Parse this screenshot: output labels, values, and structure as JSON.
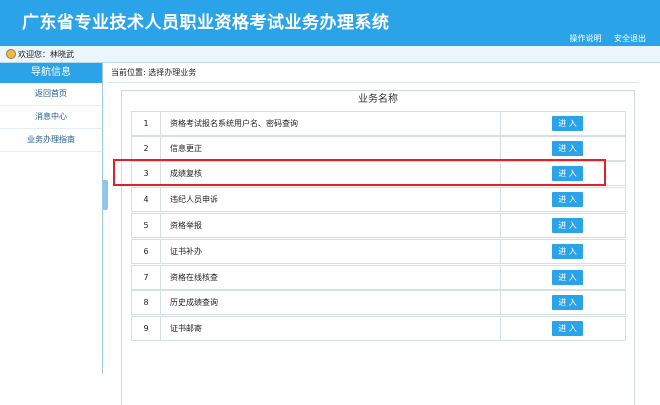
{
  "header": {
    "title": "广东省专业技术人员职业资格考试业务办理系统",
    "links": {
      "help": "操作说明",
      "logout": "安全退出"
    }
  },
  "userbar": {
    "welcome": "欢迎您：林晓武"
  },
  "sidebar": {
    "heading": "导航信息",
    "items": [
      {
        "label": "返回首页"
      },
      {
        "label": "消息中心"
      },
      {
        "label": "业务办理指南"
      }
    ]
  },
  "main": {
    "breadcrumb": "当前位置: 选择办理业务",
    "table_header": "业务名称",
    "rows": [
      {
        "num": "1",
        "name": "资格考试报名系统用户名、密码查询",
        "action": "进 入"
      },
      {
        "num": "2",
        "name": "信息更正",
        "action": "进 入"
      },
      {
        "num": "3",
        "name": "成绩复核",
        "action": "进 入"
      },
      {
        "num": "4",
        "name": "违纪人员申诉",
        "action": "进 入"
      },
      {
        "num": "5",
        "name": "资格举报",
        "action": "进 入"
      },
      {
        "num": "6",
        "name": "证书补办",
        "action": "进 入"
      },
      {
        "num": "7",
        "name": "资格在线核查",
        "action": "进 入"
      },
      {
        "num": "8",
        "name": "历史成绩查询",
        "action": "进 入"
      },
      {
        "num": "9",
        "name": "证书邮寄",
        "action": "进 入"
      }
    ]
  },
  "colors": {
    "accent": "#2aa3e8",
    "highlight": "#e0202a"
  }
}
